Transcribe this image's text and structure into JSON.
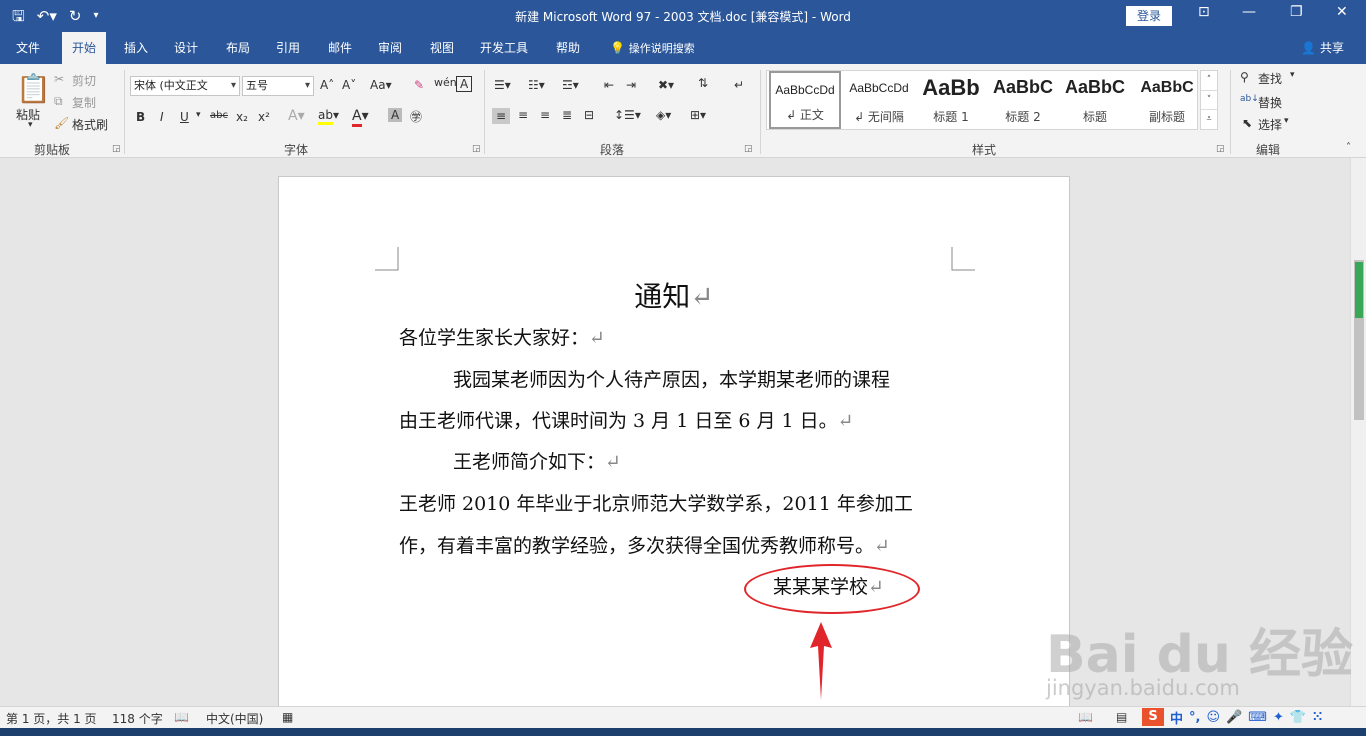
{
  "window": {
    "title": "新建 Microsoft Word 97 - 2003 文档.doc [兼容模式] - Word",
    "login": "登录"
  },
  "tabs": [
    "文件",
    "开始",
    "插入",
    "设计",
    "布局",
    "引用",
    "邮件",
    "审阅",
    "视图",
    "开发工具",
    "帮助"
  ],
  "tell_me": "操作说明搜索",
  "share": "共享",
  "clipboard": {
    "paste": "粘贴",
    "cut": "剪切",
    "copy": "复制",
    "format_painter": "格式刷",
    "label": "剪贴板"
  },
  "font": {
    "font_name": "宋体 (中文正文",
    "font_size": "五号",
    "label": "字体",
    "bold": "B",
    "italic": "I",
    "underline": "U",
    "strike": "abc",
    "sub": "x₂",
    "sup": "x²"
  },
  "paragraph": {
    "label": "段落"
  },
  "styles": {
    "items": [
      {
        "preview": "AaBbCcDd",
        "name": "↲ 正文"
      },
      {
        "preview": "AaBbCcDd",
        "name": "↲ 无间隔"
      },
      {
        "preview": "AaBb",
        "name": "标题 1"
      },
      {
        "preview": "AaBbC",
        "name": "标题 2"
      },
      {
        "preview": "AaBbC",
        "name": "标题"
      },
      {
        "preview": "AaBbC",
        "name": "副标题"
      }
    ],
    "label": "样式"
  },
  "editing": {
    "find": "查找",
    "replace": "替换",
    "select": "选择",
    "label": "编辑"
  },
  "document": {
    "title": "通知",
    "greeting": "各位学生家长大家好：",
    "p1_line1": "我园某老师因为个人待产原因，本学期某老师的课程",
    "p1_line2": "由王老师代课，代课时间为 3 月 1 日至 6 月 1 日。",
    "p2": "王老师简介如下：",
    "p3_line1": "王老师 2010 年毕业于北京师范大学数学系，2011 年参加工",
    "p3_line2": "作，有着丰富的教学经验，多次获得全国优秀教师称号。",
    "signature": "某某某学校",
    "para_mark": "↵"
  },
  "status": {
    "page": "第 1 页，共 1 页",
    "words": "118 个字",
    "lang": "中文(中国)"
  },
  "ime": {
    "s": "S",
    "mode": "中"
  },
  "watermark": {
    "main": "Bai du 经验",
    "url": "jingyan.baidu.com"
  },
  "colors": {
    "title_bar": "#2b579a",
    "annotation": "#e0262a"
  }
}
